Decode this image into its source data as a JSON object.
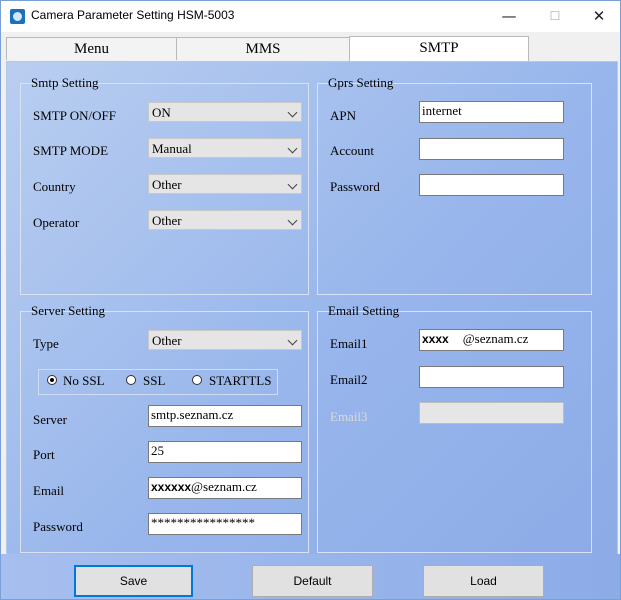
{
  "window": {
    "title": "Camera Parameter Setting HSM-5003",
    "min_glyph": "—",
    "max_glyph": "☐",
    "close_glyph": "✕"
  },
  "tabs": [
    {
      "label": "Menu"
    },
    {
      "label": "MMS"
    },
    {
      "label": "SMTP",
      "active": true
    }
  ],
  "smtp_setting": {
    "title": "Smtp Setting",
    "rows": [
      {
        "label": "SMTP ON/OFF",
        "value": "ON"
      },
      {
        "label": "SMTP MODE",
        "value": "Manual"
      },
      {
        "label": "Country",
        "value": "Other"
      },
      {
        "label": "Operator",
        "value": "Other"
      }
    ]
  },
  "gprs_setting": {
    "title": "Gprs Setting",
    "apn": {
      "label": "APN",
      "value": "internet"
    },
    "account": {
      "label": "Account",
      "value": ""
    },
    "password": {
      "label": "Password",
      "value": ""
    }
  },
  "server_setting": {
    "title": "Server Setting",
    "type": {
      "label": "Type",
      "value": "Other"
    },
    "ssl_options": [
      {
        "label": "No SSL",
        "checked": true
      },
      {
        "label": "SSL"
      },
      {
        "label": "STARTTLS"
      }
    ],
    "server": {
      "label": "Server",
      "value": "smtp.seznam.cz"
    },
    "port": {
      "label": "Port",
      "value": "25"
    },
    "email": {
      "label": "Email",
      "redacted": "xxxxxx",
      "domain": "@seznam.cz"
    },
    "password": {
      "label": "Password",
      "value": "****************"
    }
  },
  "email_setting": {
    "title": "Email Setting",
    "email1": {
      "label": "Email1",
      "redacted": "xxxx",
      "domain": "@seznam.cz"
    },
    "email2": {
      "label": "Email2",
      "value": ""
    },
    "email3": {
      "label": "Email3",
      "value": "",
      "disabled": true
    }
  },
  "buttons": {
    "save": "Save",
    "default": "Default",
    "load": "Load"
  },
  "colors": {
    "panel_gradient_start": "#b9cef0",
    "panel_gradient_end": "#8cabe7",
    "focus_border": "#0078d7"
  }
}
